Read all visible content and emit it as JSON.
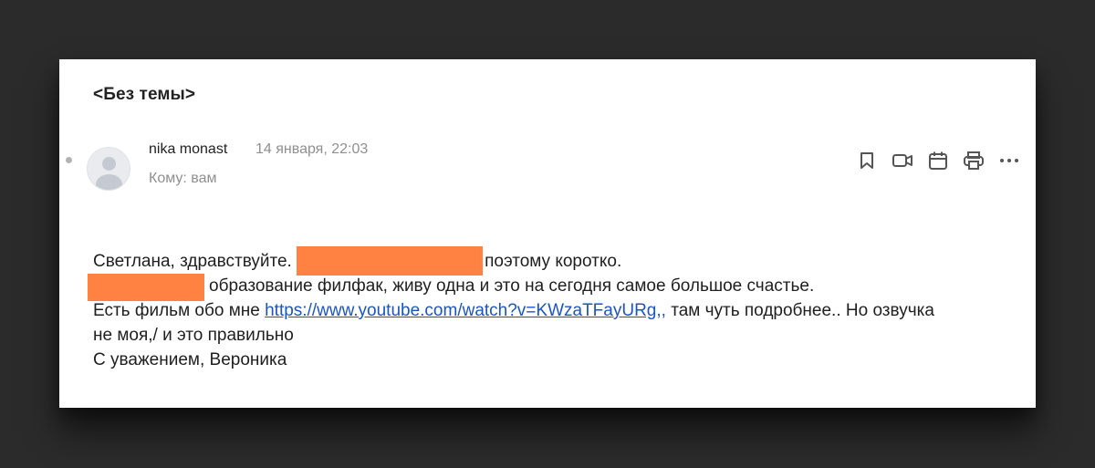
{
  "email": {
    "subject": "<Без темы>",
    "sender": "nika monast",
    "date": "14 января, 22:03",
    "to": "Кому: вам"
  },
  "actions": [
    {
      "name": "bookmark-icon"
    },
    {
      "name": "video-call-icon"
    },
    {
      "name": "calendar-icon"
    },
    {
      "name": "print-icon"
    },
    {
      "name": "more-icon"
    }
  ],
  "body": {
    "line1_start": "Светлана, здравствуйте. ",
    "line1_end": "поэтому коротко.",
    "line2_end": "образование филфак, живу одна и это на сегодня самое большое счастье.",
    "line3_start": "Есть фильм обо мне ",
    "link": "https://www.youtube.com/watch?v=KWzaTFayURg,,",
    "line3_end": " там чуть подробнее.. Но озвучка",
    "line4": "не моя,/ и это правильно",
    "line5": "С уважением, Вероника"
  },
  "colors": {
    "background": "#2b2b2b",
    "card": "#ffffff",
    "redaction": "#ff8243",
    "link": "#1a55c4",
    "muted_text": "#8f8f8f"
  }
}
